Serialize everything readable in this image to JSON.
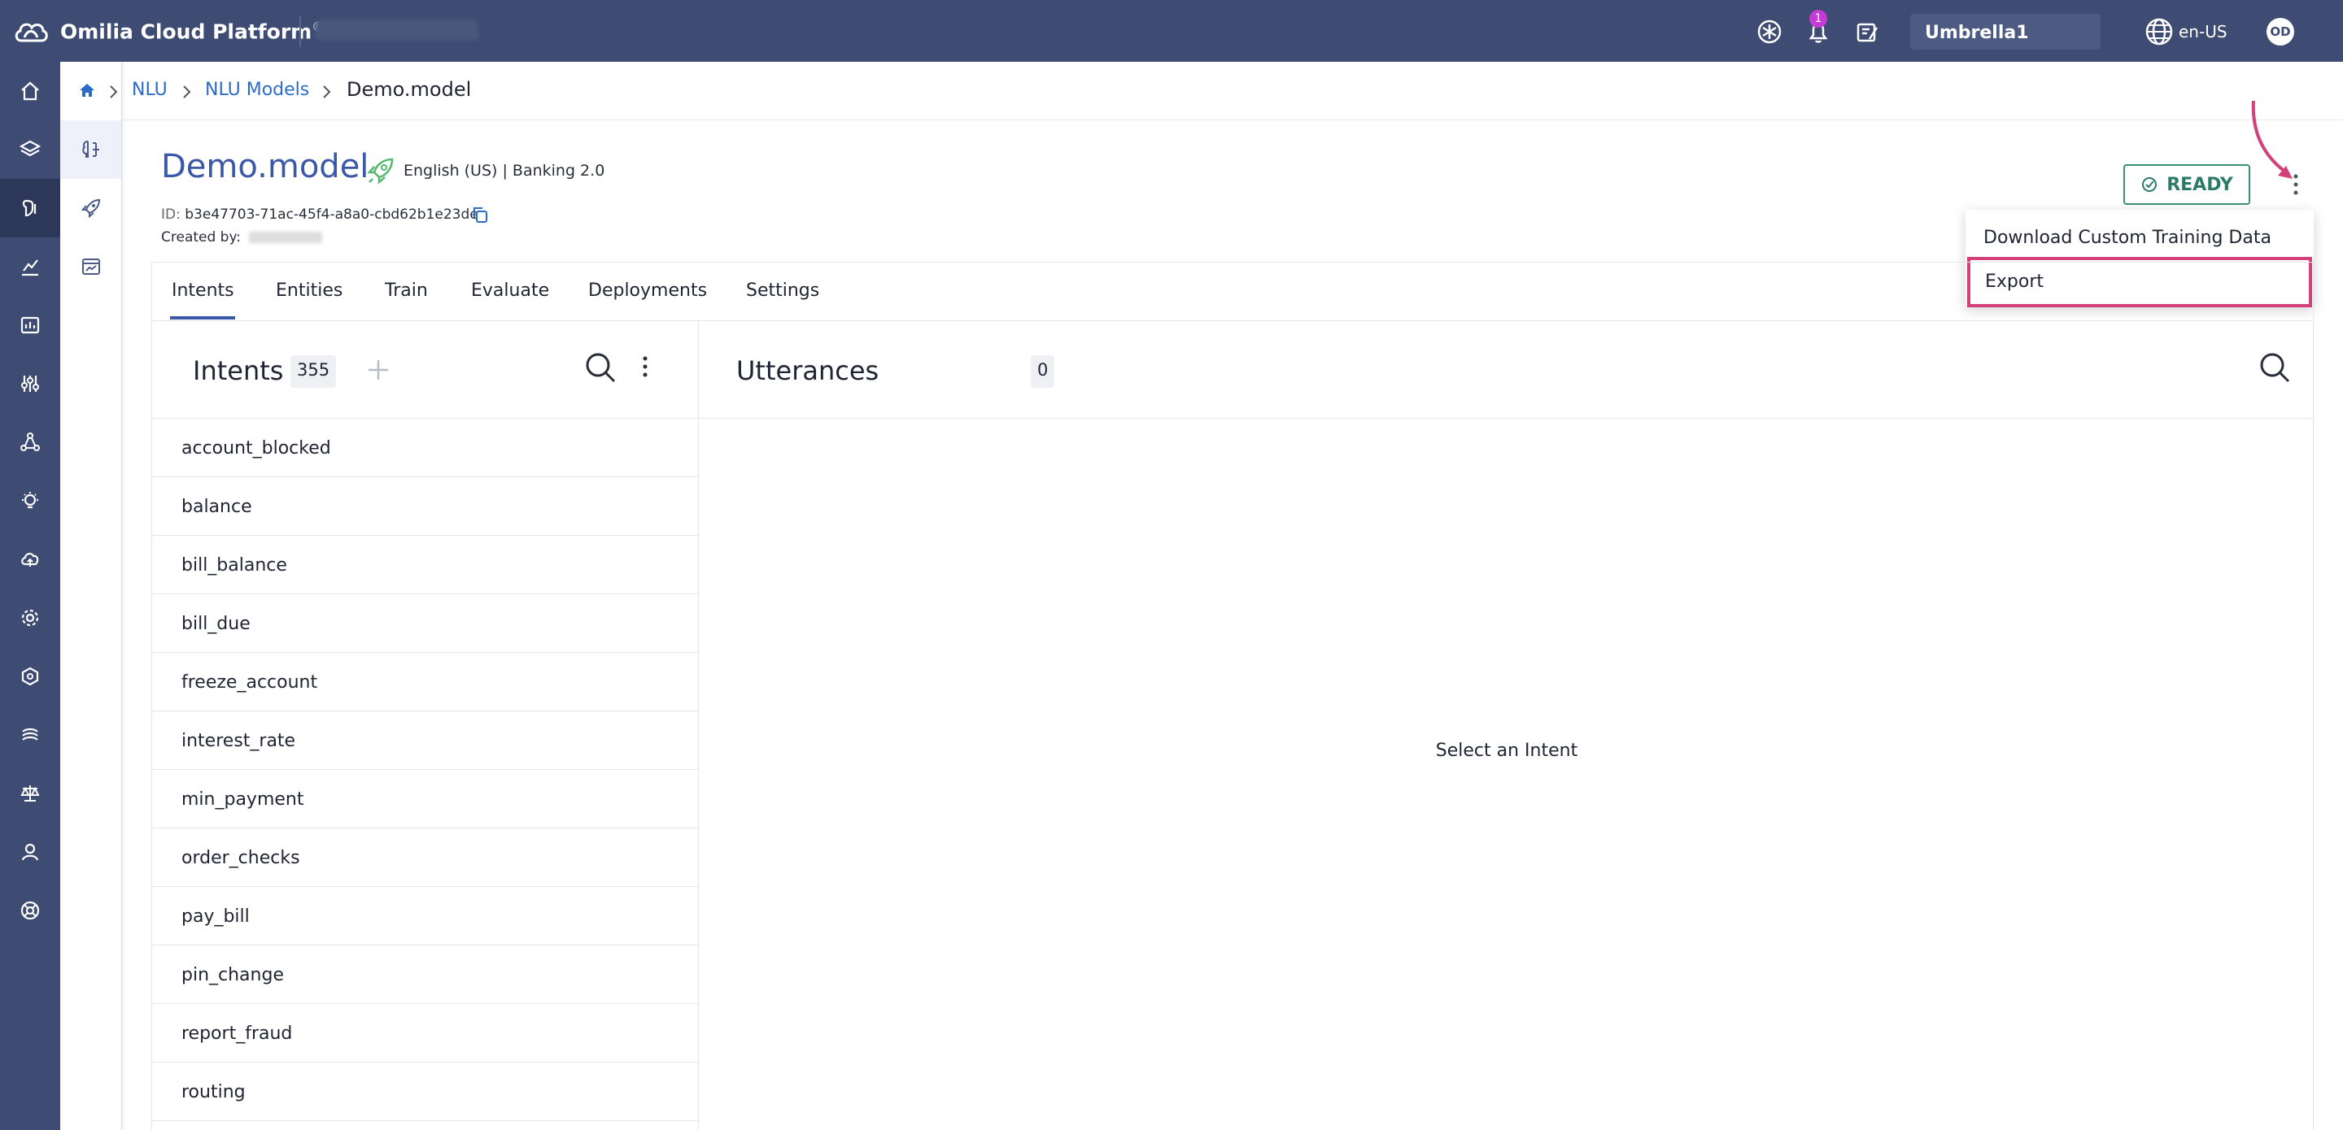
{
  "topbar": {
    "brand": "Omilia Cloud Platform",
    "brand_mark": "®",
    "notification_count": "1",
    "tenant": "Umbrella1",
    "language": "en-US",
    "user_initials": "OD"
  },
  "breadcrumb": {
    "items": [
      "NLU",
      "NLU Models"
    ],
    "current": "Demo.model"
  },
  "model": {
    "name": "Demo.model",
    "meta": "English (US) | Banking 2.0",
    "id_label": "ID:",
    "id_value": "b3e47703-71ac-45f4-a8a0-cbd62b1e23de",
    "created_label": "Created by:",
    "status": "READY"
  },
  "menu": {
    "items": [
      "Download Custom Training Data",
      "Export"
    ]
  },
  "tabs": [
    "Intents",
    "Entities",
    "Train",
    "Evaluate",
    "Deployments",
    "Settings"
  ],
  "intents": {
    "title": "Intents",
    "count": "355",
    "items": [
      "account_blocked",
      "balance",
      "bill_balance",
      "bill_due",
      "freeze_account",
      "interest_rate",
      "min_payment",
      "order_checks",
      "pay_bill",
      "pin_change",
      "report_fraud",
      "routing"
    ]
  },
  "utterances": {
    "title": "Utterances",
    "count": "0",
    "empty_message": "Select an Intent"
  },
  "colors": {
    "nav_bg": "#3e4b72",
    "accent": "#3b57a8",
    "ready": "#2b7b66",
    "highlight": "#d2417c"
  }
}
